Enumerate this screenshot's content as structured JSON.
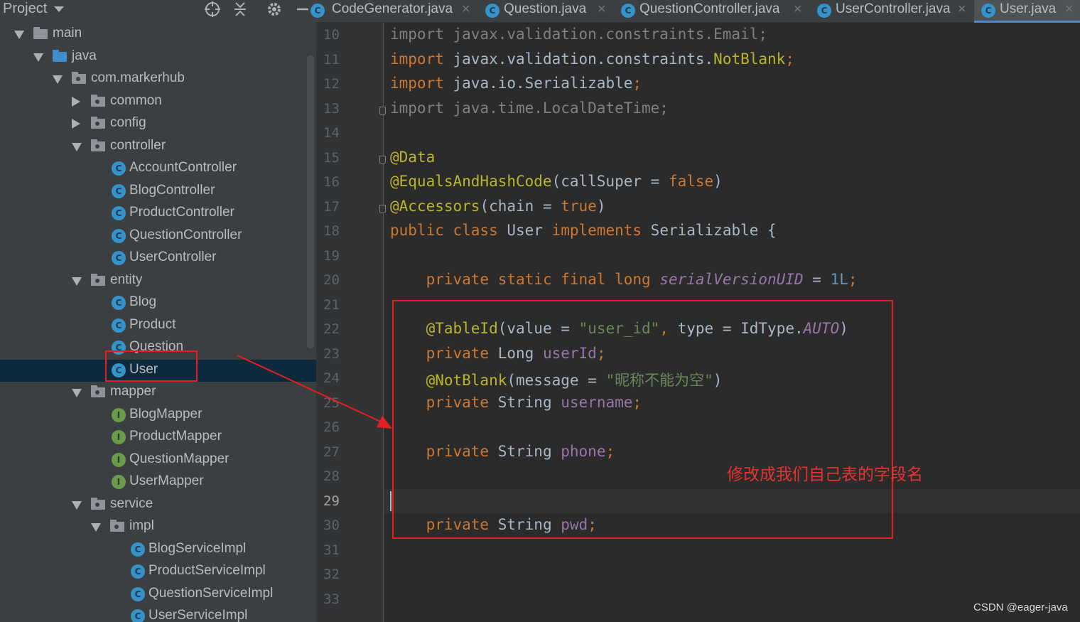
{
  "sidebar": {
    "title": "Project",
    "tree": [
      {
        "label": "main",
        "type": "folder",
        "depth": 0,
        "expanded": true
      },
      {
        "label": "java",
        "type": "folder-blue",
        "depth": 1,
        "expanded": true
      },
      {
        "label": "com.markerhub",
        "type": "package",
        "depth": 2,
        "expanded": true
      },
      {
        "label": "common",
        "type": "package",
        "depth": 3,
        "expanded": false
      },
      {
        "label": "config",
        "type": "package",
        "depth": 3,
        "expanded": false
      },
      {
        "label": "controller",
        "type": "package",
        "depth": 3,
        "expanded": true
      },
      {
        "label": "AccountController",
        "type": "class",
        "depth": 4
      },
      {
        "label": "BlogController",
        "type": "class",
        "depth": 4
      },
      {
        "label": "ProductController",
        "type": "class",
        "depth": 4
      },
      {
        "label": "QuestionController",
        "type": "class",
        "depth": 4
      },
      {
        "label": "UserController",
        "type": "class",
        "depth": 4
      },
      {
        "label": "entity",
        "type": "package",
        "depth": 3,
        "expanded": true
      },
      {
        "label": "Blog",
        "type": "class",
        "depth": 4
      },
      {
        "label": "Product",
        "type": "class",
        "depth": 4
      },
      {
        "label": "Question",
        "type": "class",
        "depth": 4
      },
      {
        "label": "User",
        "type": "class",
        "depth": 4,
        "selected": true
      },
      {
        "label": "mapper",
        "type": "package",
        "depth": 3,
        "expanded": true
      },
      {
        "label": "BlogMapper",
        "type": "interface",
        "depth": 4
      },
      {
        "label": "ProductMapper",
        "type": "interface",
        "depth": 4
      },
      {
        "label": "QuestionMapper",
        "type": "interface",
        "depth": 4
      },
      {
        "label": "UserMapper",
        "type": "interface",
        "depth": 4
      },
      {
        "label": "service",
        "type": "package",
        "depth": 3,
        "expanded": true
      },
      {
        "label": "impl",
        "type": "package",
        "depth": 4,
        "expanded": true
      },
      {
        "label": "BlogServiceImpl",
        "type": "class",
        "depth": 5
      },
      {
        "label": "ProductServiceImpl",
        "type": "class",
        "depth": 5
      },
      {
        "label": "QuestionServiceImpl",
        "type": "class",
        "depth": 5
      },
      {
        "label": "UserServiceImpl",
        "type": "class",
        "depth": 5
      }
    ]
  },
  "tabs": [
    {
      "label": "CodeGenerator.java",
      "active": false
    },
    {
      "label": "Question.java",
      "active": false
    },
    {
      "label": "QuestionController.java",
      "active": false
    },
    {
      "label": "UserController.java",
      "active": false
    },
    {
      "label": "User.java",
      "active": true
    }
  ],
  "editor": {
    "current_line": "29",
    "lines": [
      {
        "n": "10",
        "tokens": [
          [
            "gray",
            "import javax.validation.constraints.Email;"
          ]
        ]
      },
      {
        "n": "11",
        "tokens": [
          [
            "kw",
            "import "
          ],
          [
            "",
            "javax.validation.constraints."
          ],
          [
            "ann",
            "NotBlank"
          ],
          [
            "kw",
            ";"
          ]
        ]
      },
      {
        "n": "12",
        "tokens": [
          [
            "kw",
            "import "
          ],
          [
            "",
            "java.io.Serializable"
          ],
          [
            "kw",
            ";"
          ]
        ]
      },
      {
        "n": "13",
        "tokens": [
          [
            "gray",
            "import java.time.LocalDateTime;"
          ]
        ]
      },
      {
        "n": "14",
        "tokens": []
      },
      {
        "n": "15",
        "tokens": [
          [
            "ann",
            "@Data"
          ]
        ]
      },
      {
        "n": "16",
        "tokens": [
          [
            "ann",
            "@EqualsAndHashCode"
          ],
          [
            "",
            "(callSuper = "
          ],
          [
            "kw",
            "false"
          ],
          [
            "",
            ")"
          ]
        ]
      },
      {
        "n": "17",
        "tokens": [
          [
            "ann",
            "@Accessors"
          ],
          [
            "",
            "(chain = "
          ],
          [
            "kw",
            "true"
          ],
          [
            "",
            ")"
          ]
        ]
      },
      {
        "n": "18",
        "tokens": [
          [
            "kw",
            "public class "
          ],
          [
            "",
            "User "
          ],
          [
            "kw",
            "implements "
          ],
          [
            "",
            "Serializable {"
          ]
        ]
      },
      {
        "n": "19",
        "tokens": []
      },
      {
        "n": "20",
        "tokens": [
          [
            "",
            "    "
          ],
          [
            "kw",
            "private static final long "
          ],
          [
            "ital",
            "serialVersionUID"
          ],
          [
            "",
            " = "
          ],
          [
            "num",
            "1L"
          ],
          [
            "kw",
            ";"
          ]
        ]
      },
      {
        "n": "21",
        "tokens": []
      },
      {
        "n": "22",
        "tokens": [
          [
            "",
            "    "
          ],
          [
            "ann",
            "@TableId"
          ],
          [
            "",
            "(value = "
          ],
          [
            "str",
            "\"user_id\""
          ],
          [
            "kw",
            ", "
          ],
          [
            "",
            "type = IdType."
          ],
          [
            "ital",
            "AUTO"
          ],
          [
            "",
            ")"
          ]
        ]
      },
      {
        "n": "23",
        "tokens": [
          [
            "",
            "    "
          ],
          [
            "kw",
            "private "
          ],
          [
            "",
            "Long "
          ],
          [
            "fld",
            "userId"
          ],
          [
            "kw",
            ";"
          ]
        ]
      },
      {
        "n": "24",
        "tokens": [
          [
            "",
            "    "
          ],
          [
            "ann",
            "@NotBlank"
          ],
          [
            "",
            "(message = "
          ],
          [
            "str",
            "\"昵称不能为空\""
          ],
          [
            "",
            ")"
          ]
        ]
      },
      {
        "n": "25",
        "tokens": [
          [
            "",
            "    "
          ],
          [
            "kw",
            "private "
          ],
          [
            "",
            "String "
          ],
          [
            "fld",
            "username"
          ],
          [
            "kw",
            ";"
          ]
        ]
      },
      {
        "n": "26",
        "tokens": []
      },
      {
        "n": "27",
        "tokens": [
          [
            "",
            "    "
          ],
          [
            "kw",
            "private "
          ],
          [
            "",
            "String "
          ],
          [
            "fld",
            "phone"
          ],
          [
            "kw",
            ";"
          ]
        ]
      },
      {
        "n": "28",
        "tokens": []
      },
      {
        "n": "29",
        "tokens": []
      },
      {
        "n": "30",
        "tokens": [
          [
            "",
            "    "
          ],
          [
            "kw",
            "private "
          ],
          [
            "",
            "String "
          ],
          [
            "fld",
            "pwd"
          ],
          [
            "kw",
            ";"
          ]
        ]
      },
      {
        "n": "31",
        "tokens": []
      },
      {
        "n": "32",
        "tokens": []
      },
      {
        "n": "33",
        "tokens": []
      }
    ]
  },
  "annotation": "修改成我们自己表的字段名",
  "watermark": "CSDN @eager-java",
  "colors": {
    "keyword": "#cc7832",
    "annotation": "#bbb529",
    "string": "#6a8759",
    "number": "#6897bb",
    "field": "#9876aa",
    "highlight_box": "#e51f1f",
    "selection": "#0d293e"
  },
  "icons": {
    "locate": "crosshair-icon",
    "collapse": "collapse-all-icon",
    "settings": "gear-icon",
    "hide": "minimize-icon"
  }
}
